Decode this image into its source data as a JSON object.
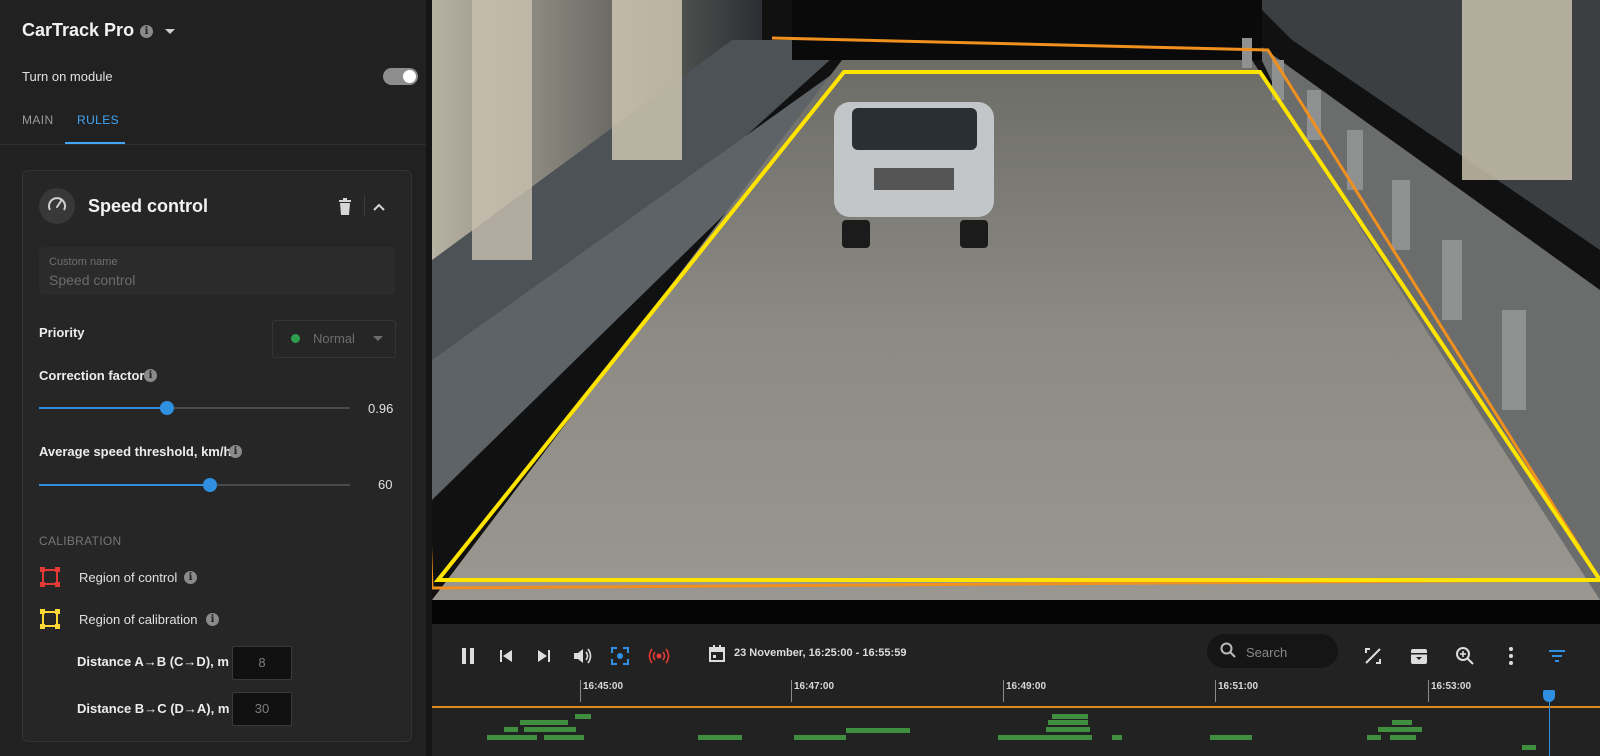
{
  "app": {
    "title": "CarTrack Pro"
  },
  "module": {
    "toggle_label": "Turn on module",
    "enabled": true
  },
  "tabs": [
    {
      "label": "MAIN"
    },
    {
      "label": "RULES",
      "active": true
    }
  ],
  "rule": {
    "title": "Speed control",
    "custom_name": {
      "label": "Custom name",
      "value": "Speed control"
    },
    "priority": {
      "label": "Priority",
      "value": "Normal",
      "dot_color": "#2e9e4f"
    },
    "correction_factor": {
      "label": "Correction factor",
      "value": "0.96",
      "fraction": 0.41
    },
    "speed_threshold": {
      "label": "Average speed threshold, km/h",
      "value": "60",
      "fraction": 0.55
    },
    "calibration": {
      "heading": "CALIBRATION",
      "region_control": {
        "label": "Region of control",
        "color": "#e53935"
      },
      "region_calibration": {
        "label": "Region of calibration",
        "color": "#fdd835"
      },
      "distance_ab": {
        "label": "Distance A→B (C→D), m",
        "value": "8"
      },
      "distance_bc": {
        "label": "Distance B→C (D→A), m",
        "value": "30"
      }
    }
  },
  "player": {
    "date_range": "23 November, 16:25:00 - 16:55:59",
    "search_placeholder": "Search",
    "timeline_ticks": [
      "16:45:00",
      "16:47:00",
      "16:49:00",
      "16:51:00",
      "16:53:00"
    ]
  },
  "colors": {
    "accent": "#42a5f5",
    "timeline": "#e08a1a",
    "events": "#3f8f3f"
  },
  "icons": [
    "info-icon",
    "dropdown-caret-icon",
    "speedometer-icon",
    "trash-icon",
    "chevron-up-icon",
    "pause-icon",
    "skip-previous-icon",
    "skip-next-icon",
    "volume-icon",
    "fit-screen-icon",
    "live-broadcast-icon",
    "calendar-icon",
    "search-icon",
    "zones-off-icon",
    "archive-icon",
    "zoom-in-icon",
    "more-vert-icon",
    "filter-icon"
  ]
}
